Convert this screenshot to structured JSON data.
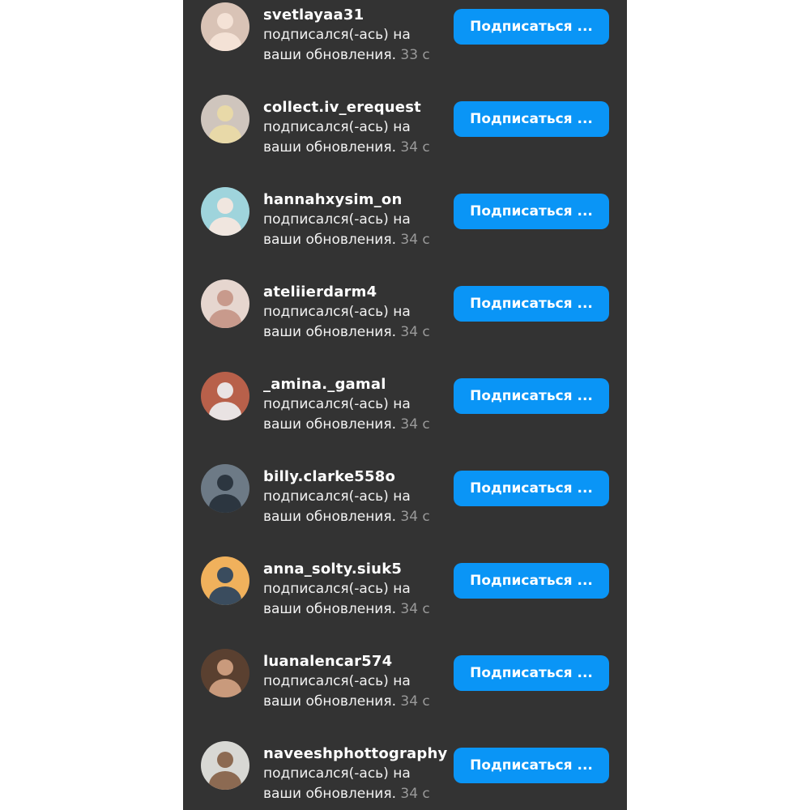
{
  "notifications": [
    {
      "username": "svetlayaa31",
      "action_line1": "подписался(-ась) на",
      "action_line2": "ваши обновления.",
      "time": "33 с",
      "button_label": "Подписаться ...",
      "avatar": {
        "icon": "profile-photo-icon",
        "bg": "#d9c3b6",
        "fg": "#f4e2d6"
      }
    },
    {
      "username": "collect.iv_erequest",
      "action_line1": "подписался(-ась) на",
      "action_line2": "ваши обновления.",
      "time": "34 с",
      "button_label": "Подписаться ...",
      "avatar": {
        "icon": "profile-photo-icon",
        "bg": "#cfc5bd",
        "fg": "#e8d9a8"
      }
    },
    {
      "username": "hannahxysim_on",
      "action_line1": "подписался(-ась) на",
      "action_line2": "ваши обновления.",
      "time": "34 с",
      "button_label": "Подписаться ...",
      "avatar": {
        "icon": "profile-photo-icon",
        "bg": "#9fd4dc",
        "fg": "#f0e6df"
      }
    },
    {
      "username": "ateliierdarm4",
      "action_line1": "подписался(-ась) на",
      "action_line2": "ваши обновления.",
      "time": "34 с",
      "button_label": "Подписаться ...",
      "avatar": {
        "icon": "profile-photo-icon",
        "bg": "#e6d6cf",
        "fg": "#c89a8c"
      }
    },
    {
      "username": "_amina._gamal",
      "action_line1": "подписался(-ась) на",
      "action_line2": "ваши обновления.",
      "time": "34 с",
      "button_label": "Подписаться ...",
      "avatar": {
        "icon": "profile-photo-icon",
        "bg": "#b8604a",
        "fg": "#e9e3e3"
      }
    },
    {
      "username": "billy.clarke558o",
      "action_line1": "подписался(-ась) на",
      "action_line2": "ваши обновления.",
      "time": "34 с",
      "button_label": "Подписаться ...",
      "avatar": {
        "icon": "profile-photo-icon",
        "bg": "#6d7a86",
        "fg": "#2c3640"
      }
    },
    {
      "username": "anna_solty.siuk5",
      "action_line1": "подписался(-ась) на",
      "action_line2": "ваши обновления.",
      "time": "34 с",
      "button_label": "Подписаться ...",
      "avatar": {
        "icon": "profile-photo-icon",
        "bg": "#f0b15c",
        "fg": "#3a4c5e"
      }
    },
    {
      "username": "luanalencar574",
      "action_line1": "подписался(-ась) на",
      "action_line2": "ваши обновления.",
      "time": "34 с",
      "button_label": "Подписаться ...",
      "avatar": {
        "icon": "profile-photo-icon",
        "bg": "#5a4030",
        "fg": "#c99a7c"
      }
    },
    {
      "username": "naveeshphottography",
      "action_line1": "подписался(-ась) на",
      "action_line2": "ваши обновления.",
      "time": "34 с",
      "button_label": "Подписаться ...",
      "avatar": {
        "icon": "profile-photo-icon",
        "bg": "#d8d8d4",
        "fg": "#8c6a52"
      }
    }
  ],
  "colors": {
    "background": "#333333",
    "button": "#0a95f6",
    "username": "#ffffff",
    "body_text": "#f2f2f2",
    "time_text": "#9a9a9a"
  }
}
